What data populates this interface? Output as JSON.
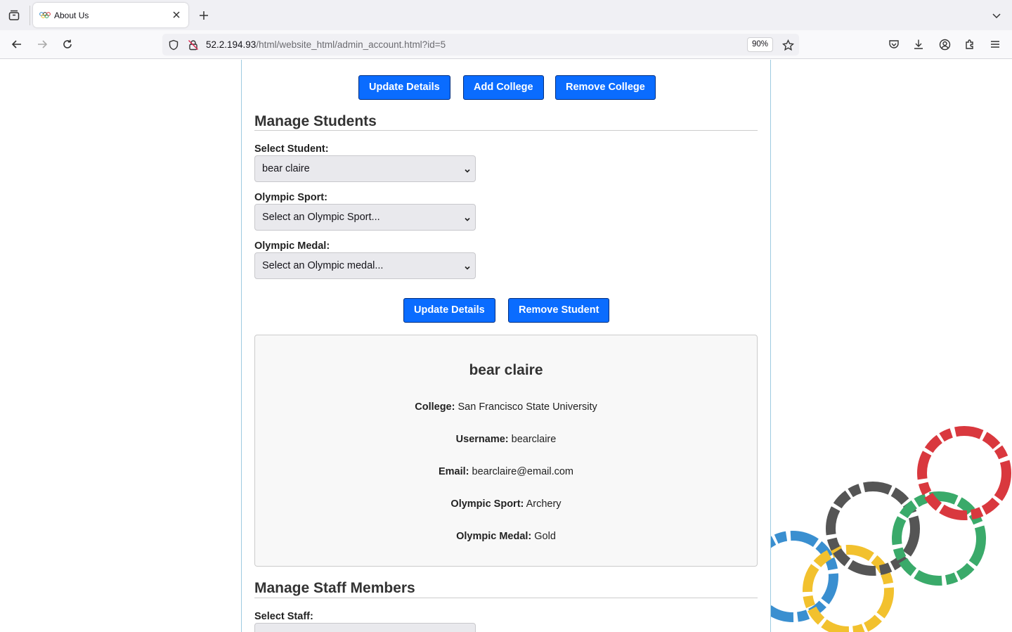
{
  "browser": {
    "tab_title": "About Us",
    "url_host": "52.2.194.93",
    "url_path": "/html/website_html/admin_account.html?id=5",
    "zoom": "90%"
  },
  "colleges": {
    "buttons": {
      "update": "Update Details",
      "add": "Add College",
      "remove": "Remove College"
    }
  },
  "students": {
    "heading": "Manage Students",
    "select_student_label": "Select Student:",
    "select_student_value": "bear claire",
    "sport_label": "Olympic Sport:",
    "sport_value": "Select an Olympic Sport...",
    "medal_label": "Olympic Medal:",
    "medal_value": "Select an Olympic medal...",
    "buttons": {
      "update": "Update Details",
      "remove": "Remove Student"
    },
    "card": {
      "name": "bear claire",
      "college_label": "College:",
      "college_value": "San Francisco State University",
      "username_label": "Username:",
      "username_value": "bearclaire",
      "email_label": "Email:",
      "email_value": "bearclaire@email.com",
      "sport_label": "Olympic Sport:",
      "sport_value": "Archery",
      "medal_label": "Olympic Medal:",
      "medal_value": "Gold"
    }
  },
  "staff": {
    "heading": "Manage Staff Members",
    "select_staff_label": "Select Staff:"
  },
  "colors": {
    "primary_button": "#0a6cff",
    "ring_blue": "#3a8fd0",
    "ring_yellow": "#f2c12e",
    "ring_black": "#555555",
    "ring_green": "#3aaa6a",
    "ring_red": "#d9383e"
  },
  "icons": [
    "tab-list-icon",
    "olympic-favicon",
    "close-icon",
    "plus-icon",
    "chevron-down-icon",
    "back-icon",
    "forward-icon",
    "reload-icon",
    "shield-icon",
    "insecure-lock-icon",
    "star-icon",
    "pocket-icon",
    "download-icon",
    "account-icon",
    "extensions-icon",
    "menu-icon"
  ]
}
